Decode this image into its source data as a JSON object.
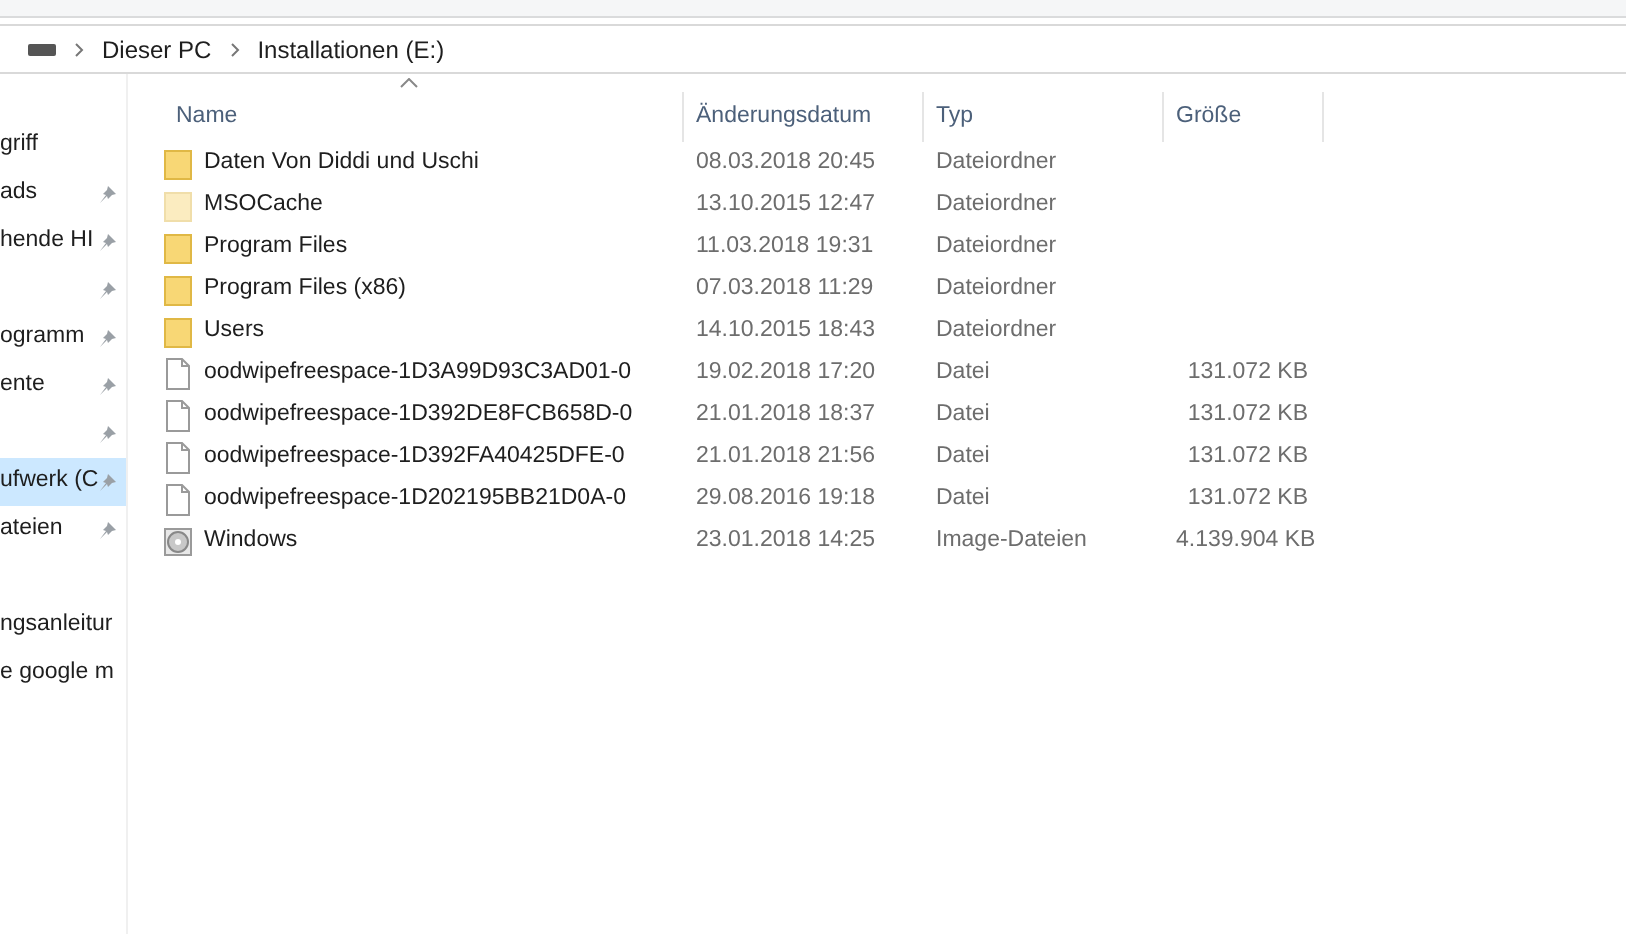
{
  "breadcrumb": [
    {
      "label": "Dieser PC"
    },
    {
      "label": "Installationen (E:)"
    }
  ],
  "sidebar": {
    "items": [
      {
        "label": "griff",
        "pinned": false,
        "selected": false
      },
      {
        "label": "ads",
        "pinned": true,
        "selected": false
      },
      {
        "label": "hende HI",
        "pinned": true,
        "selected": false
      },
      {
        "pinned": true,
        "selected": false
      },
      {
        "label": "ogramm",
        "pinned": true,
        "selected": false
      },
      {
        "label": "ente",
        "pinned": true,
        "selected": false
      },
      {
        "pinned": true,
        "selected": false
      },
      {
        "label": "ufwerk (C",
        "pinned": true,
        "selected": true
      },
      {
        "label": "ateien",
        "pinned": true,
        "selected": false
      },
      {
        "pinned": false,
        "selected": false
      },
      {
        "label": "ngsanleitur",
        "pinned": false,
        "selected": false
      },
      {
        "label": "e google m",
        "pinned": false,
        "selected": false
      }
    ]
  },
  "table": {
    "columns": [
      {
        "label": "Name",
        "sorted": true
      },
      {
        "label": "Änderungsdatum",
        "sorted": false
      },
      {
        "label": "Typ",
        "sorted": false
      },
      {
        "label": "Größe",
        "sorted": false
      }
    ],
    "rows": [
      {
        "kind": "folder",
        "hidden": false,
        "name": "Daten Von Diddi und Uschi",
        "date": "08.03.2018 20:45",
        "type": "Dateiordner"
      },
      {
        "kind": "folder",
        "hidden": true,
        "name": "MSOCache",
        "date": "13.10.2015 12:47",
        "type": "Dateiordner"
      },
      {
        "kind": "folder",
        "hidden": false,
        "name": "Program Files",
        "date": "11.03.2018 19:31",
        "type": "Dateiordner"
      },
      {
        "kind": "folder",
        "hidden": false,
        "name": "Program Files (x86)",
        "date": "07.03.2018 11:29",
        "type": "Dateiordner"
      },
      {
        "kind": "folder",
        "hidden": false,
        "name": "Users",
        "date": "14.10.2015 18:43",
        "type": "Dateiordner"
      },
      {
        "kind": "file",
        "hidden": false,
        "name": "oodwipefreespace-1D3A99D93C3AD01-0",
        "date": "19.02.2018 17:20",
        "type": "Datei",
        "size": "131.072 KB"
      },
      {
        "kind": "file",
        "hidden": false,
        "name": "oodwipefreespace-1D392DE8FCB658D-0",
        "date": "21.01.2018 18:37",
        "type": "Datei",
        "size": "131.072 KB"
      },
      {
        "kind": "file",
        "hidden": false,
        "name": "oodwipefreespace-1D392FA40425DFE-0",
        "date": "21.01.2018 21:56",
        "type": "Datei",
        "size": "131.072 KB"
      },
      {
        "kind": "file",
        "hidden": false,
        "name": "oodwipefreespace-1D202195BB21D0A-0",
        "date": "29.08.2016 19:18",
        "type": "Datei",
        "size": "131.072 KB"
      },
      {
        "kind": "disc",
        "hidden": false,
        "name": "Windows",
        "date": "23.01.2018 14:25",
        "type": "Image-Dateien",
        "size": "4.139.904 KB"
      }
    ]
  }
}
